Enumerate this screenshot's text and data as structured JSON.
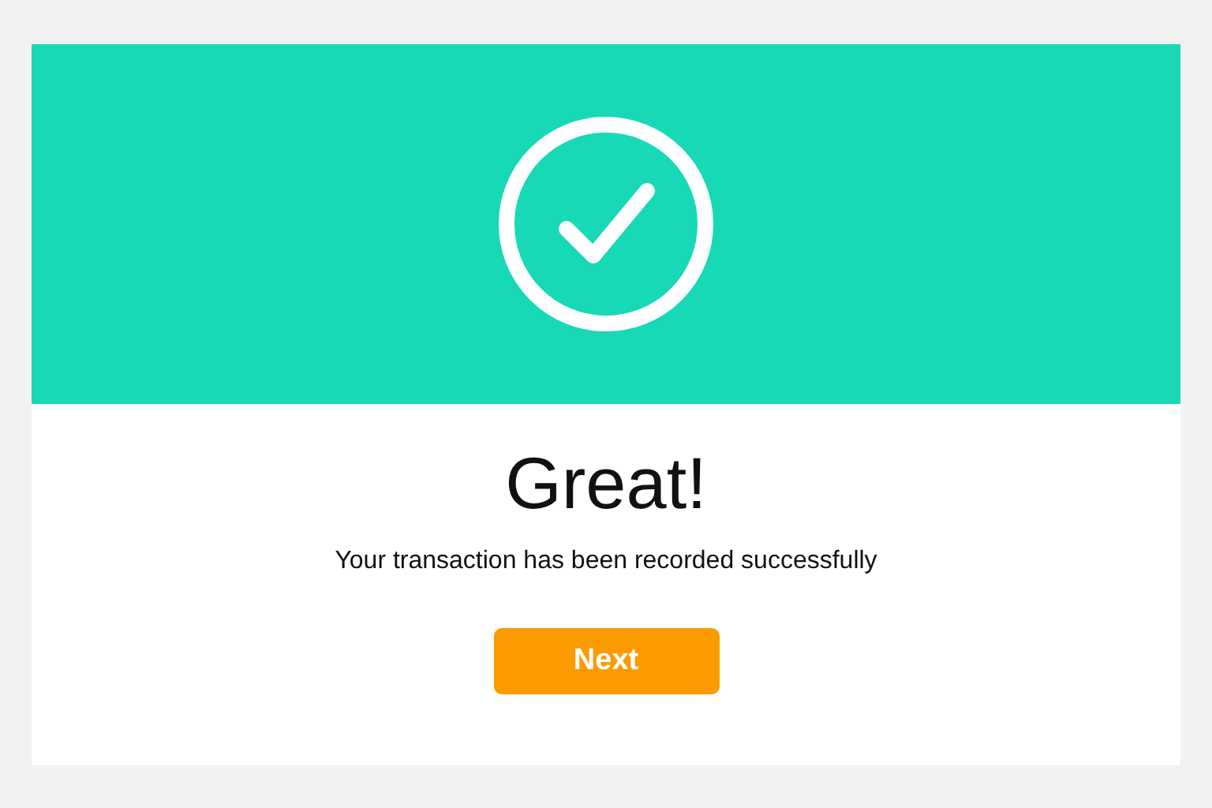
{
  "title": "Great!",
  "message": "Your transaction has been recorded successfully",
  "button": {
    "label": "Next"
  }
}
